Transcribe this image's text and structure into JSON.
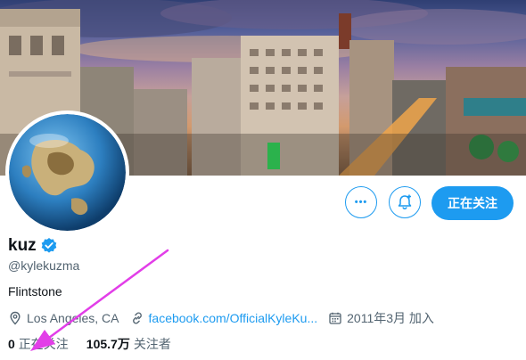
{
  "profile": {
    "name": "kuz",
    "handle": "@kylekuzma",
    "bio": "Flintstone",
    "location": "Los Angeles, CA",
    "website": "facebook.com/OfficialKyleKu...",
    "joined": "2011年3月 加入"
  },
  "actions": {
    "more_label": "•••",
    "follow_label": "正在关注"
  },
  "stats": {
    "following_count": "0",
    "following_label": "正在关注",
    "followers_count": "105.7万",
    "followers_label": "关注者"
  },
  "colors": {
    "accent": "#1d9bf0",
    "annotation_arrow": "#e23ee8",
    "secondary_text": "#536471"
  },
  "icons": {
    "more": "more-horizontal-icon",
    "notify": "bell-plus-icon",
    "verified": "verified-badge-icon",
    "location": "location-pin-icon",
    "link": "link-icon",
    "calendar": "calendar-icon"
  }
}
